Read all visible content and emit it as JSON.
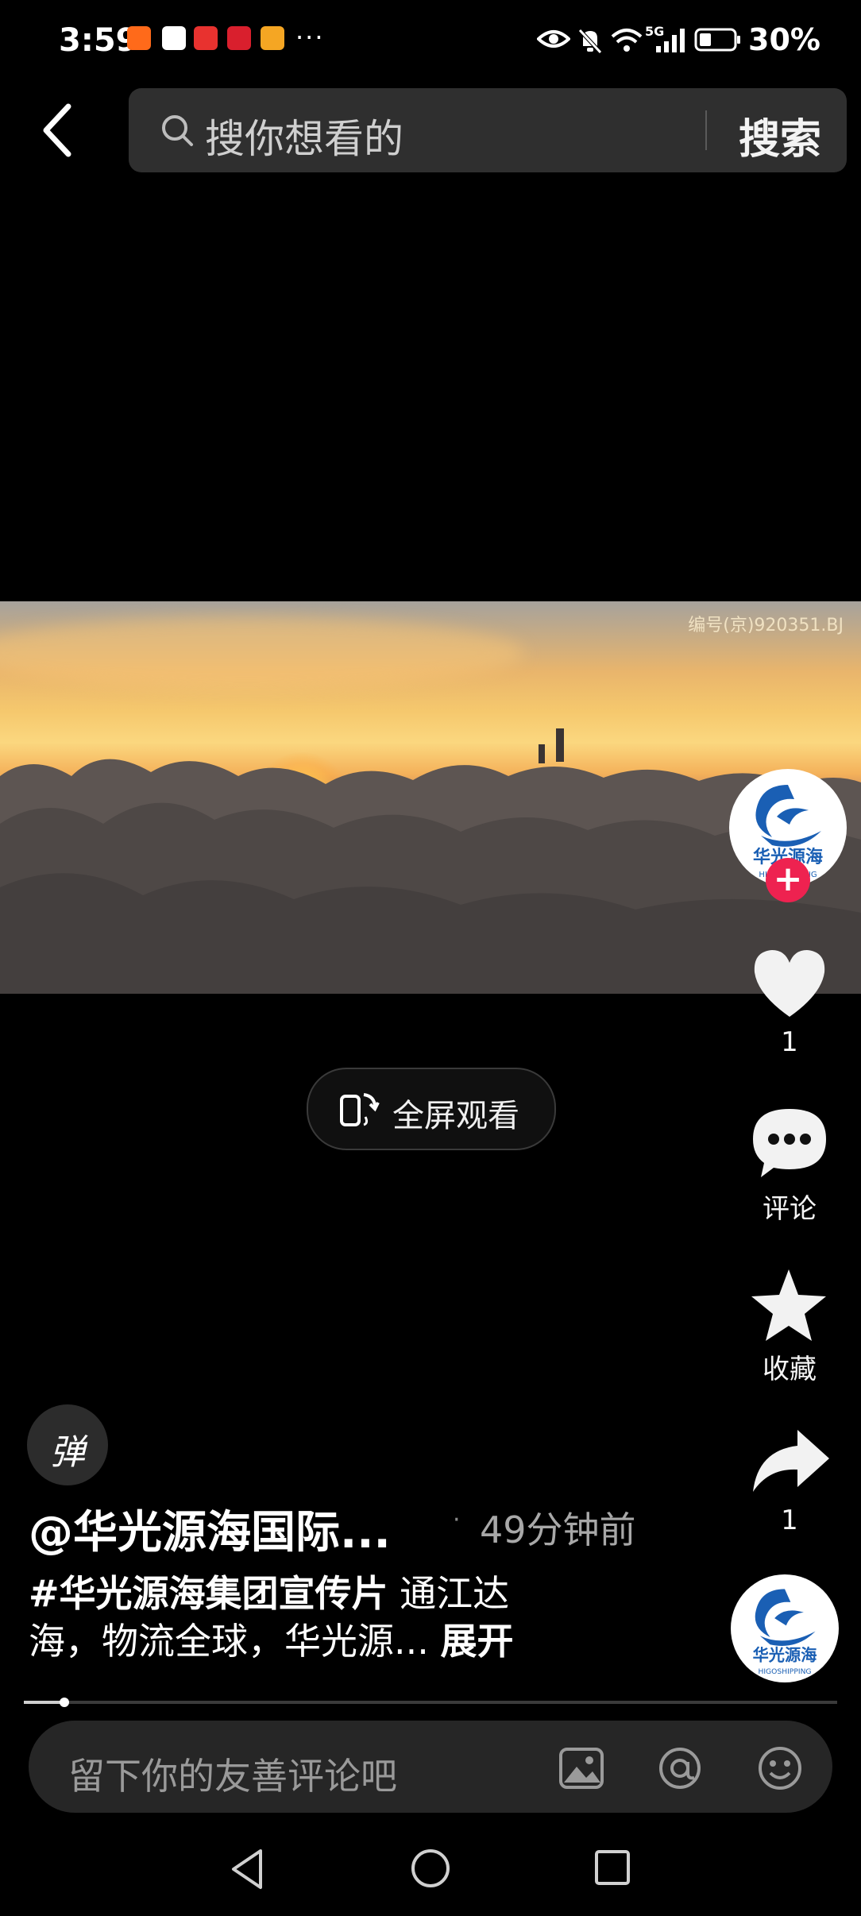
{
  "status_bar": {
    "time": "3:59",
    "overflow": "···",
    "battery": "30%",
    "network": "5G",
    "app_icons": [
      "kuaishou-icon",
      "taobao-icon",
      "toutiao-icon",
      "pinduoduo-icon",
      "app-icon"
    ]
  },
  "header": {
    "search_placeholder": "搜你想看的",
    "search_button": "搜索"
  },
  "video": {
    "watermark": "编号(京)920351.BJ",
    "fullscreen_label": "全屏观看"
  },
  "rail": {
    "like_count": "1",
    "comment_label": "评论",
    "favorite_label": "收藏",
    "share_count": "1",
    "brand_name": "华光源海",
    "brand_en": "HIGOSHIPPING"
  },
  "post": {
    "danmaku_label": "弹",
    "author": "@华光源海国际...",
    "separator": "·",
    "time": "49分钟前",
    "hashtag": "#华光源海集团宣传片",
    "caption_line1_rest": " 通江达",
    "caption_line2": "海，物流全球，华光源...",
    "expand_label": "展开"
  },
  "progress": {
    "fraction": 0.05
  },
  "comment": {
    "placeholder": "留下你的友善评论吧"
  },
  "colors": {
    "accent": "#ee2250",
    "brand_blue": "#1a5fb4"
  }
}
